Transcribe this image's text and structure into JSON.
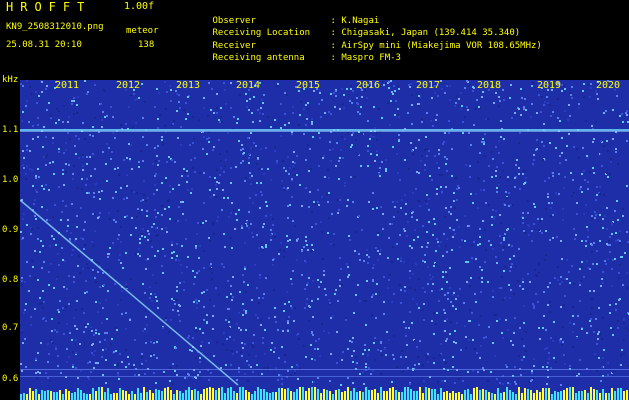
{
  "header": {
    "app_title": "HROFFT",
    "version": "1.00f",
    "filename": "KN9_2508312010.png",
    "mode": "meteor",
    "datetime": "25.08.31 20:10",
    "count": "138",
    "observer_label": "Observer",
    "observer_value": ": K.Nagai",
    "location_label": "Receiving Location",
    "location_value": ": Chigasaki, Japan (139.414 35.340)",
    "receiver_label": "Receiver",
    "receiver_value": ": AirSpy mini (Miakejima VOR 108.65MHz)",
    "antenna_label": "Receiving antenna",
    "antenna_value": ": Maspro FM-3"
  },
  "y_axis": {
    "unit": "kHz",
    "ticks": [
      "1.1",
      "1.0",
      "0.9",
      "0.8",
      "0.7",
      "0.6"
    ]
  },
  "x_axis": {
    "ticks": [
      "2011",
      "2012",
      "2013",
      "2014",
      "2015",
      "2016",
      "2017",
      "2018",
      "2019",
      "2020"
    ]
  },
  "colors": {
    "background": "#000000",
    "label": "#ffff00",
    "spectrogram_base": "#1e2ea8",
    "carrier_line": "#4cc9ff"
  }
}
